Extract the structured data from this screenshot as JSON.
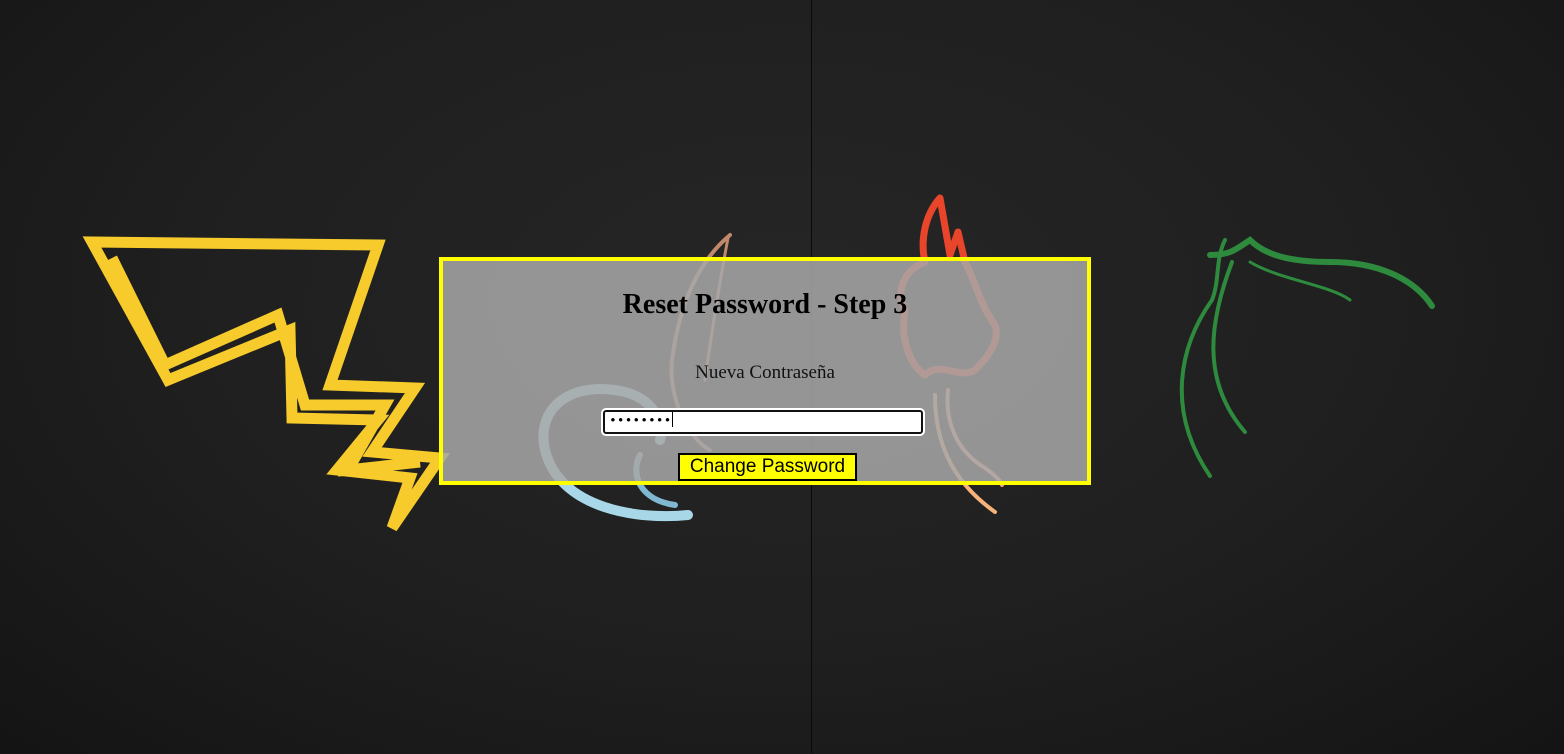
{
  "page": {
    "background_color": "#1f1f1f",
    "accent_color": "#ffff00"
  },
  "reset_form": {
    "title": "Reset Password - Step 3",
    "password_label": "Nueva Contraseña",
    "password_value": "••••••••",
    "submit_label": "Change Password"
  },
  "background_art": {
    "icons": [
      "lightning-bolt-icon",
      "water-swirl-icon",
      "flame-icon",
      "leaf-icon"
    ],
    "colors": {
      "electric": "#f6cb2b",
      "water": "#a8d8e8",
      "fire": "#e8452b",
      "grass": "#2e8b3e"
    }
  }
}
